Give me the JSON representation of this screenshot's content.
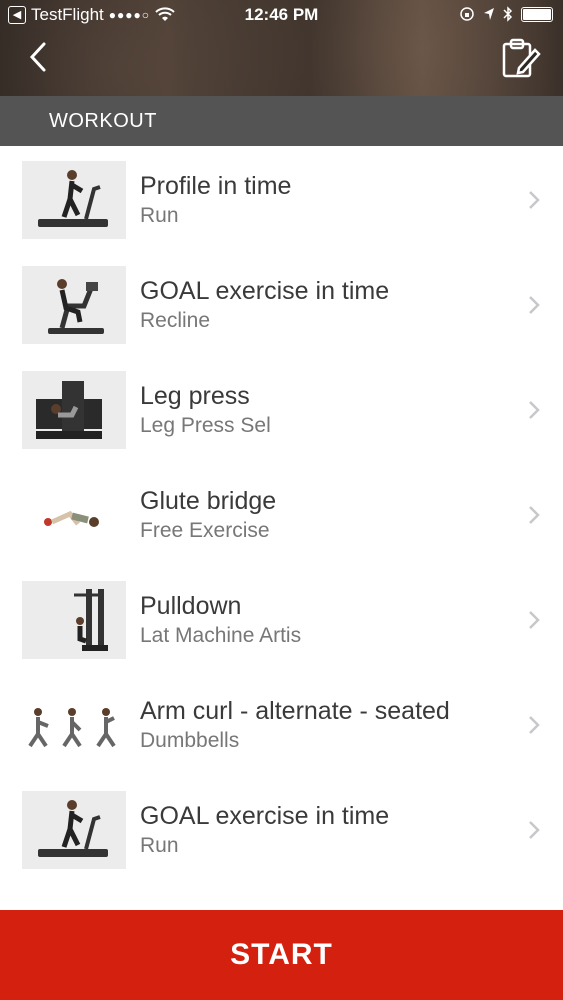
{
  "status_bar": {
    "carrier": "TestFlight",
    "signal": "●●●●○",
    "time": "12:46 PM"
  },
  "nav": {
    "back_icon": "chevron-left-icon",
    "action_icon": "clipboard-edit-icon"
  },
  "section": {
    "title": "WORKOUT"
  },
  "exercises": [
    {
      "title": "Profile in time",
      "subtitle": "Run",
      "thumb": "treadmill"
    },
    {
      "title": "GOAL exercise in time",
      "subtitle": "Recline",
      "thumb": "recumbent-bike"
    },
    {
      "title": "Leg press",
      "subtitle": "Leg Press Sel",
      "thumb": "leg-press"
    },
    {
      "title": "Glute bridge",
      "subtitle": "Free Exercise",
      "thumb": "glute-bridge"
    },
    {
      "title": "Pulldown",
      "subtitle": "Lat Machine Artis",
      "thumb": "lat-machine"
    },
    {
      "title": "Arm curl - alternate - seated",
      "subtitle": "Dumbbells",
      "thumb": "arm-curl"
    },
    {
      "title": "GOAL exercise in time",
      "subtitle": "Run",
      "thumb": "treadmill"
    }
  ],
  "start_button": {
    "label": "START"
  },
  "colors": {
    "accent": "#d4200f",
    "section_bar": "#545454"
  }
}
